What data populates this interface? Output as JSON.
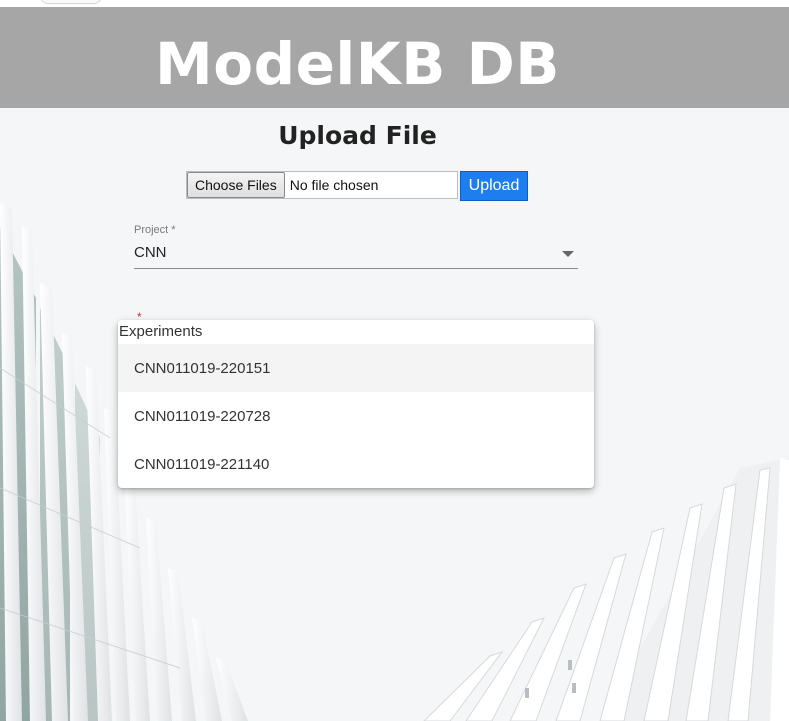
{
  "banner": {
    "title": "ModelKB DB"
  },
  "upload": {
    "heading": "Upload File",
    "choose_button": "Choose Files",
    "file_status": "No file chosen",
    "upload_button": "Upload"
  },
  "project": {
    "label": "Project *",
    "value": "CNN"
  },
  "experiments": {
    "required_mark": "*",
    "header": "Experiments",
    "options": [
      "CNN011019-220151",
      "CNN011019-220728",
      "CNN011019-221140"
    ]
  },
  "colors": {
    "banner_bg": "#a6a6a6",
    "upload_button_bg": "#1e7ef0",
    "page_bg": "#f5f6f7"
  }
}
